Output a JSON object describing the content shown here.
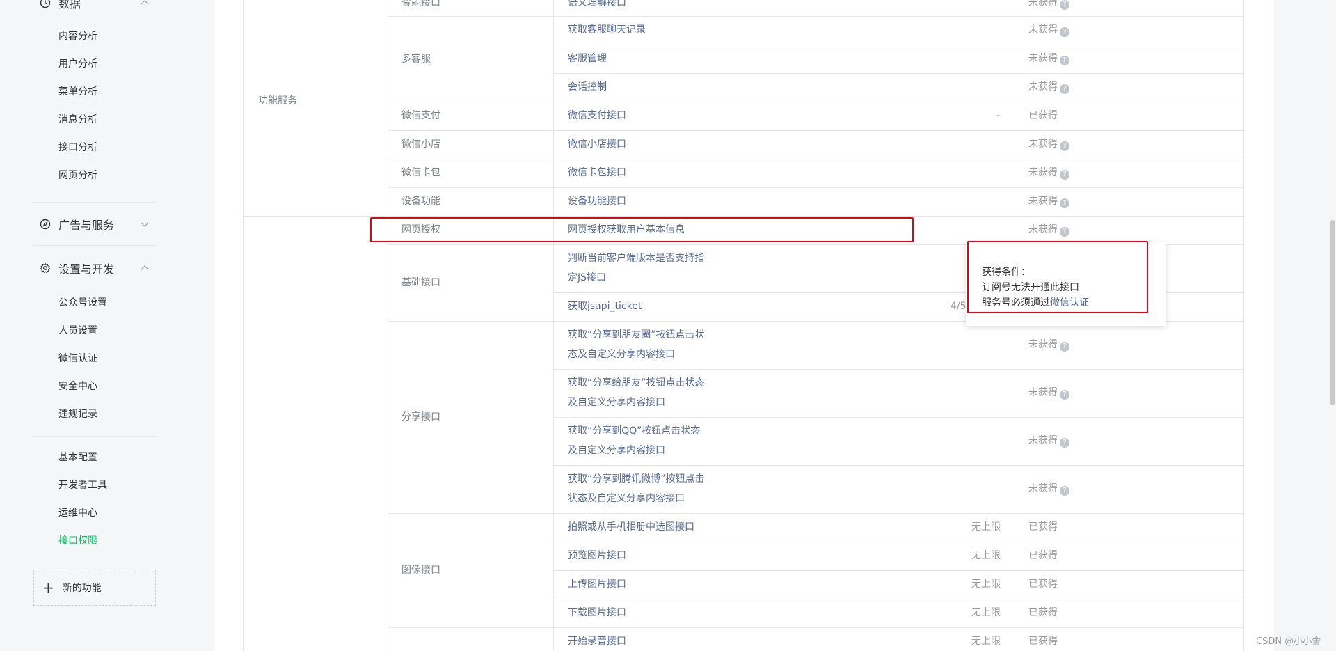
{
  "sidebar": {
    "data_head": "数据",
    "data_items": [
      "内容分析",
      "用户分析",
      "菜单分析",
      "消息分析",
      "接口分析",
      "网页分析"
    ],
    "ads_head": "广告与服务",
    "settings_head": "设置与开发",
    "settings_items": [
      "公众号设置",
      "人员设置",
      "微信认证",
      "安全中心",
      "违规记录"
    ],
    "dev_items": [
      "基本配置",
      "开发者工具",
      "运维中心",
      "接口权限"
    ],
    "new_feature": "新的功能"
  },
  "table": {
    "top_partial": {
      "cat": "智能接口",
      "name": "语义理解接口",
      "status": "未获得"
    },
    "groups": [
      {
        "label": "功能服务"
      }
    ],
    "rows": [
      {
        "cat": "多客服",
        "name": "获取客服聊天记录",
        "limit": "",
        "status": "未获得"
      },
      {
        "cat": "",
        "name": "客服管理",
        "limit": "",
        "status": "未获得"
      },
      {
        "cat": "",
        "name": "会话控制",
        "limit": "",
        "status": "未获得"
      },
      {
        "cat": "微信支付",
        "name": "微信支付接口",
        "limit": "-",
        "status": "已获得"
      },
      {
        "cat": "微信小店",
        "name": "微信小店接口",
        "limit": "",
        "status": "未获得"
      },
      {
        "cat": "微信卡包",
        "name": "微信卡包接口",
        "limit": "",
        "status": "未获得"
      },
      {
        "cat": "设备功能",
        "name": "设备功能接口",
        "limit": "",
        "status": "未获得"
      },
      {
        "cat": "网页授权",
        "name": "网页授权获取用户基本信息",
        "limit": "",
        "status": "未获得"
      },
      {
        "cat": "基础接口",
        "name_l1": "判断当前客户端版本是否支持指",
        "name_l2": "定JS接口",
        "limit": "",
        "status": ""
      },
      {
        "cat": "",
        "name": "获取jsapi_ticket",
        "limit": "4/5",
        "status": ""
      },
      {
        "cat": "分享接口",
        "name_l1": "获取“分享到朋友圈”按钮点击状",
        "name_l2": "态及自定义分享内容接口",
        "limit": "",
        "status": "未获得"
      },
      {
        "cat": "",
        "name_l1": "获取“分享给朋友”按钮点击状态",
        "name_l2": "及自定义分享内容接口",
        "limit": "",
        "status": "未获得"
      },
      {
        "cat": "",
        "name_l1": "获取“分享到QQ”按钮点击状态",
        "name_l2": "及自定义分享内容接口",
        "limit": "",
        "status": "未获得"
      },
      {
        "cat": "",
        "name_l1": "获取“分享到腾讯微博”按钮点击",
        "name_l2": "状态及自定义分享内容接口",
        "limit": "",
        "status": "未获得"
      },
      {
        "cat": "图像接口",
        "name": "拍照或从手机相册中选图接口",
        "limit": "无上限",
        "status": "已获得"
      },
      {
        "cat": "",
        "name": "预览图片接口",
        "limit": "无上限",
        "status": "已获得"
      },
      {
        "cat": "",
        "name": "上传图片接口",
        "limit": "无上限",
        "status": "已获得"
      },
      {
        "cat": "",
        "name": "下载图片接口",
        "limit": "无上限",
        "status": "已获得"
      },
      {
        "cat": "",
        "name": "开始录音接口",
        "limit": "无上限",
        "status": "已获得"
      }
    ]
  },
  "popup": {
    "title": "获得条件：",
    "line1": "订阅号无法开通此接口",
    "line2_prefix": "服务号必须通过",
    "line2_link": "微信认证"
  },
  "watermark": "CSDN @小小舍",
  "colors": {
    "accent": "#07c160",
    "link": "#576b95",
    "highlight": "#e60012"
  }
}
